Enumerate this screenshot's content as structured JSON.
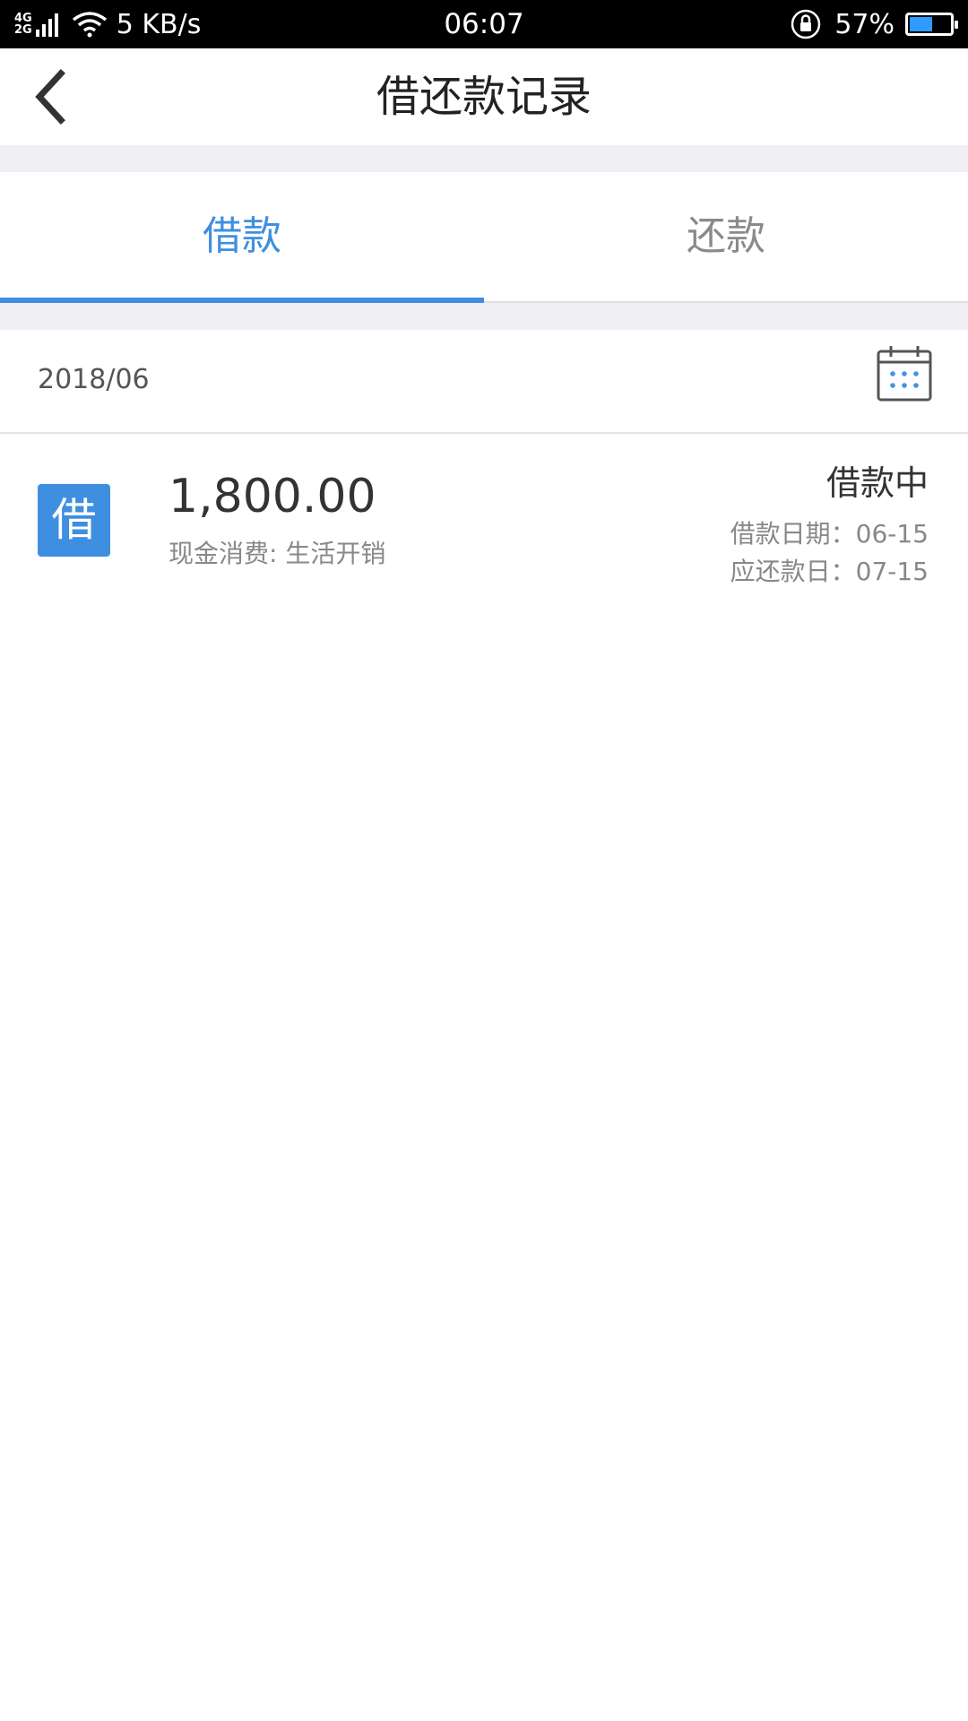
{
  "status_bar": {
    "network_type_top": "4G",
    "network_type_bottom": "2G",
    "net_speed": "5 KB/s",
    "time": "06:07",
    "battery_percent": "57%",
    "battery_level": 0.57,
    "battery_color": "#2f9bff"
  },
  "header": {
    "title": "借还款记录",
    "back_icon": "chevron-left-icon"
  },
  "tabs": [
    {
      "label": "借款",
      "active": true
    },
    {
      "label": "还款",
      "active": false
    }
  ],
  "month": {
    "label": "2018/06",
    "calendar_icon": "calendar-icon"
  },
  "loans": [
    {
      "badge": "借",
      "amount": "1,800.00",
      "description": "现金消费: 生活开销",
      "status": "借款中",
      "loan_date": "借款日期：06-15",
      "due_date": "应还款日：07-15"
    }
  ],
  "colors": {
    "accent": "#3f8fe0",
    "divider_bg": "#f0f0f4"
  }
}
